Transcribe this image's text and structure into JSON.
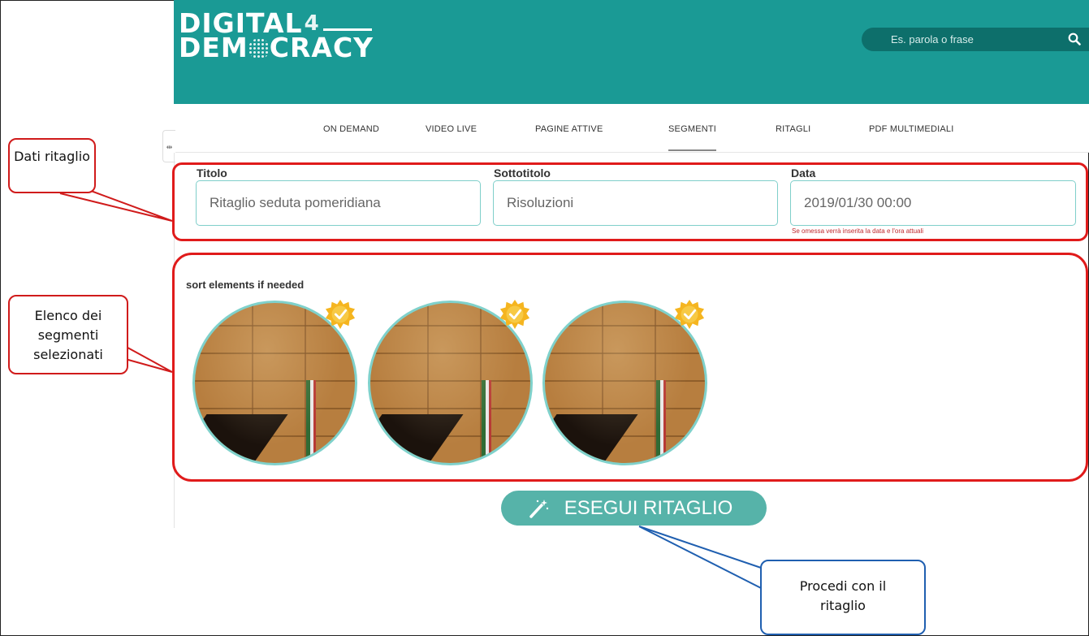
{
  "logo": {
    "line1": "DIGITAL",
    "four": "4",
    "line2_a": "DEM",
    "line2_b": "CRACY"
  },
  "search": {
    "placeholder": "Es. parola o frase",
    "icon": "search-icon"
  },
  "nav": {
    "items": [
      {
        "label": "ON DEMAND"
      },
      {
        "label": "VIDEO LIVE"
      },
      {
        "label": "PAGINE ATTIVE"
      },
      {
        "label": "SEGMENTI",
        "active": true
      },
      {
        "label": "RITAGLI"
      },
      {
        "label": "PDF MULTIMEDIALI"
      }
    ],
    "toggle_glyph": "⇹"
  },
  "form": {
    "titolo": {
      "label": "Titolo",
      "value": "Ritaglio seduta pomeridiana"
    },
    "sottotitolo": {
      "label": "Sottotitolo",
      "value": "Risoluzioni"
    },
    "data": {
      "label": "Data",
      "value": "2019/01/30 00:00",
      "hint": "Se omessa verrà inserita la data e l'ora attuali"
    }
  },
  "segments": {
    "title": "sort elements if needed",
    "count": 3,
    "badge_icon": "check-seal-icon"
  },
  "execute_button": {
    "label": "ESEGUI RITAGLIO",
    "icon": "magic-wand-icon"
  },
  "callouts": {
    "dati_ritaglio": "Dati ritaglio",
    "elenco": "Elenco dei segmenti selezionati",
    "procedi": "Procedi con il ritaglio"
  },
  "colors": {
    "header": "#1a9a95",
    "accent": "#56b3a9",
    "annotation_red": "#e01b1b",
    "annotation_blue": "#1f5fb0"
  }
}
